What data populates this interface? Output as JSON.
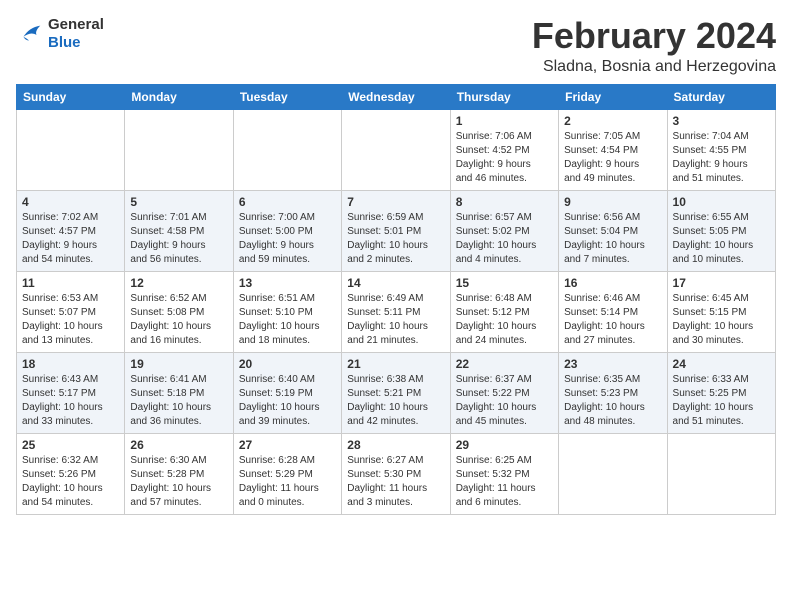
{
  "header": {
    "logo_line1": "General",
    "logo_line2": "Blue",
    "month_year": "February 2024",
    "location": "Sladna, Bosnia and Herzegovina"
  },
  "weekdays": [
    "Sunday",
    "Monday",
    "Tuesday",
    "Wednesday",
    "Thursday",
    "Friday",
    "Saturday"
  ],
  "weeks": [
    [
      {
        "day": "",
        "info": ""
      },
      {
        "day": "",
        "info": ""
      },
      {
        "day": "",
        "info": ""
      },
      {
        "day": "",
        "info": ""
      },
      {
        "day": "1",
        "info": "Sunrise: 7:06 AM\nSunset: 4:52 PM\nDaylight: 9 hours\nand 46 minutes."
      },
      {
        "day": "2",
        "info": "Sunrise: 7:05 AM\nSunset: 4:54 PM\nDaylight: 9 hours\nand 49 minutes."
      },
      {
        "day": "3",
        "info": "Sunrise: 7:04 AM\nSunset: 4:55 PM\nDaylight: 9 hours\nand 51 minutes."
      }
    ],
    [
      {
        "day": "4",
        "info": "Sunrise: 7:02 AM\nSunset: 4:57 PM\nDaylight: 9 hours\nand 54 minutes."
      },
      {
        "day": "5",
        "info": "Sunrise: 7:01 AM\nSunset: 4:58 PM\nDaylight: 9 hours\nand 56 minutes."
      },
      {
        "day": "6",
        "info": "Sunrise: 7:00 AM\nSunset: 5:00 PM\nDaylight: 9 hours\nand 59 minutes."
      },
      {
        "day": "7",
        "info": "Sunrise: 6:59 AM\nSunset: 5:01 PM\nDaylight: 10 hours\nand 2 minutes."
      },
      {
        "day": "8",
        "info": "Sunrise: 6:57 AM\nSunset: 5:02 PM\nDaylight: 10 hours\nand 4 minutes."
      },
      {
        "day": "9",
        "info": "Sunrise: 6:56 AM\nSunset: 5:04 PM\nDaylight: 10 hours\nand 7 minutes."
      },
      {
        "day": "10",
        "info": "Sunrise: 6:55 AM\nSunset: 5:05 PM\nDaylight: 10 hours\nand 10 minutes."
      }
    ],
    [
      {
        "day": "11",
        "info": "Sunrise: 6:53 AM\nSunset: 5:07 PM\nDaylight: 10 hours\nand 13 minutes."
      },
      {
        "day": "12",
        "info": "Sunrise: 6:52 AM\nSunset: 5:08 PM\nDaylight: 10 hours\nand 16 minutes."
      },
      {
        "day": "13",
        "info": "Sunrise: 6:51 AM\nSunset: 5:10 PM\nDaylight: 10 hours\nand 18 minutes."
      },
      {
        "day": "14",
        "info": "Sunrise: 6:49 AM\nSunset: 5:11 PM\nDaylight: 10 hours\nand 21 minutes."
      },
      {
        "day": "15",
        "info": "Sunrise: 6:48 AM\nSunset: 5:12 PM\nDaylight: 10 hours\nand 24 minutes."
      },
      {
        "day": "16",
        "info": "Sunrise: 6:46 AM\nSunset: 5:14 PM\nDaylight: 10 hours\nand 27 minutes."
      },
      {
        "day": "17",
        "info": "Sunrise: 6:45 AM\nSunset: 5:15 PM\nDaylight: 10 hours\nand 30 minutes."
      }
    ],
    [
      {
        "day": "18",
        "info": "Sunrise: 6:43 AM\nSunset: 5:17 PM\nDaylight: 10 hours\nand 33 minutes."
      },
      {
        "day": "19",
        "info": "Sunrise: 6:41 AM\nSunset: 5:18 PM\nDaylight: 10 hours\nand 36 minutes."
      },
      {
        "day": "20",
        "info": "Sunrise: 6:40 AM\nSunset: 5:19 PM\nDaylight: 10 hours\nand 39 minutes."
      },
      {
        "day": "21",
        "info": "Sunrise: 6:38 AM\nSunset: 5:21 PM\nDaylight: 10 hours\nand 42 minutes."
      },
      {
        "day": "22",
        "info": "Sunrise: 6:37 AM\nSunset: 5:22 PM\nDaylight: 10 hours\nand 45 minutes."
      },
      {
        "day": "23",
        "info": "Sunrise: 6:35 AM\nSunset: 5:23 PM\nDaylight: 10 hours\nand 48 minutes."
      },
      {
        "day": "24",
        "info": "Sunrise: 6:33 AM\nSunset: 5:25 PM\nDaylight: 10 hours\nand 51 minutes."
      }
    ],
    [
      {
        "day": "25",
        "info": "Sunrise: 6:32 AM\nSunset: 5:26 PM\nDaylight: 10 hours\nand 54 minutes."
      },
      {
        "day": "26",
        "info": "Sunrise: 6:30 AM\nSunset: 5:28 PM\nDaylight: 10 hours\nand 57 minutes."
      },
      {
        "day": "27",
        "info": "Sunrise: 6:28 AM\nSunset: 5:29 PM\nDaylight: 11 hours\nand 0 minutes."
      },
      {
        "day": "28",
        "info": "Sunrise: 6:27 AM\nSunset: 5:30 PM\nDaylight: 11 hours\nand 3 minutes."
      },
      {
        "day": "29",
        "info": "Sunrise: 6:25 AM\nSunset: 5:32 PM\nDaylight: 11 hours\nand 6 minutes."
      },
      {
        "day": "",
        "info": ""
      },
      {
        "day": "",
        "info": ""
      }
    ]
  ]
}
